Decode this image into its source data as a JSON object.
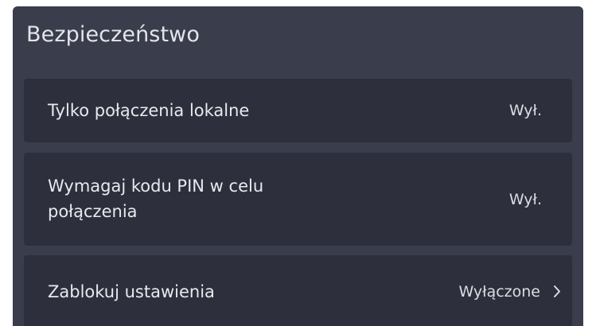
{
  "section": {
    "title": "Bezpieczeństwo"
  },
  "settings": {
    "items": [
      {
        "label": "Tylko połączenia lokalne",
        "value": "Wył."
      },
      {
        "label": "Wymagaj kodu PIN w celu połączenia",
        "value": "Wył."
      },
      {
        "label": "Zablokuj ustawienia",
        "value": "Wyłączone",
        "icon": "chevron-right-icon"
      }
    ]
  }
}
